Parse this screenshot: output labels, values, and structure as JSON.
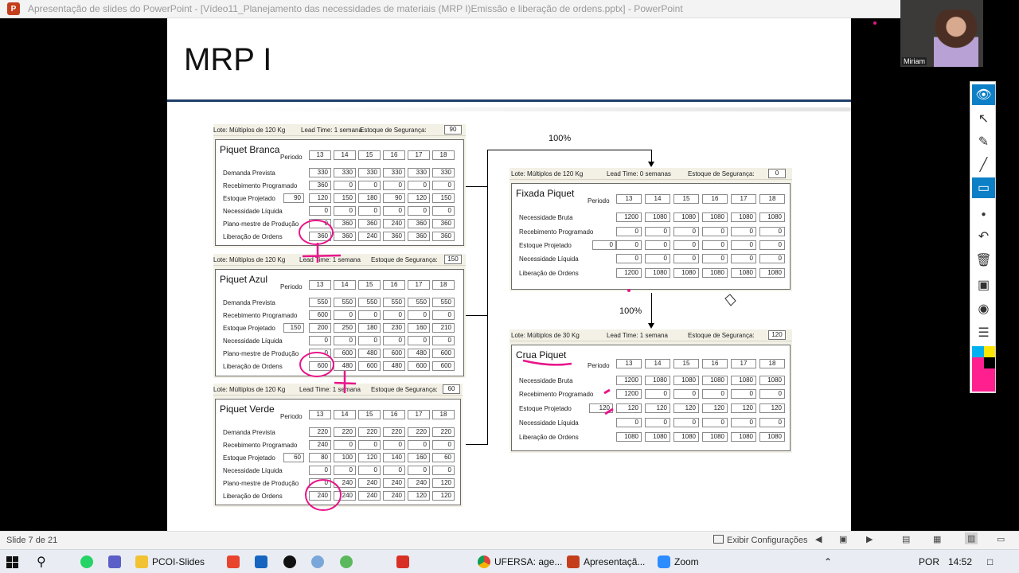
{
  "window": {
    "title": "Apresentação de slides do PowerPoint - [Vídeo11_Planejamento das necessidades de  materiais (MRP I)Emissão e liberação de ordens.pptx] - PowerPoint",
    "app_icon": "P"
  },
  "video": {
    "name": "Miriam"
  },
  "slide": {
    "title": "MRP I",
    "pct_top": "100%",
    "pct_mid": "100%",
    "periods": [
      "13",
      "14",
      "15",
      "16",
      "17",
      "18"
    ],
    "periodo_label": "Periodo",
    "panels": [
      {
        "id": "branca",
        "lote": "Lote: Múltiplos de 120 Kg",
        "lead": "Lead Time: 1 semana",
        "seg_label": "Estoque de Segurança:",
        "seg": "90",
        "name": "Piquet Branca",
        "rows": [
          {
            "label": "Demanda Prevista",
            "init": "",
            "values": [
              "330",
              "330",
              "330",
              "330",
              "330",
              "330"
            ]
          },
          {
            "label": "Recebimento Programado",
            "init": "",
            "values": [
              "360",
              "0",
              "0",
              "0",
              "0",
              "0"
            ]
          },
          {
            "label": "Estoque Projetado",
            "init": "90",
            "values": [
              "120",
              "150",
              "180",
              "90",
              "120",
              "150"
            ]
          },
          {
            "label": "Necessidade Líquida",
            "init": "",
            "values": [
              "0",
              "0",
              "0",
              "0",
              "0",
              "0"
            ]
          },
          {
            "label": "Plano-mestre de Produção",
            "init": "",
            "values": [
              "0",
              "360",
              "360",
              "240",
              "360",
              "360"
            ]
          },
          {
            "label": "Liberação de Ordens",
            "init": "",
            "values": [
              "360",
              "360",
              "240",
              "360",
              "360",
              "360"
            ]
          }
        ]
      },
      {
        "id": "azul",
        "lote": "Lote: Múltiplos de 120 Kg",
        "lead": "Lead Time: 1 semana",
        "seg_label": "Estoque de Segurança:",
        "seg": "150",
        "name": "Piquet Azul",
        "rows": [
          {
            "label": "Demanda Prevista",
            "init": "",
            "values": [
              "550",
              "550",
              "550",
              "550",
              "550",
              "550"
            ]
          },
          {
            "label": "Recebimento Programado",
            "init": "",
            "values": [
              "600",
              "0",
              "0",
              "0",
              "0",
              "0"
            ]
          },
          {
            "label": "Estoque Projetado",
            "init": "150",
            "values": [
              "200",
              "250",
              "180",
              "230",
              "160",
              "210"
            ]
          },
          {
            "label": "Necessidade Líquida",
            "init": "",
            "values": [
              "0",
              "0",
              "0",
              "0",
              "0",
              "0"
            ]
          },
          {
            "label": "Plano-mestre de Produção",
            "init": "",
            "values": [
              "0",
              "600",
              "480",
              "600",
              "480",
              "600"
            ]
          },
          {
            "label": "Liberação de Ordens",
            "init": "",
            "values": [
              "600",
              "480",
              "600",
              "480",
              "600",
              "600"
            ]
          }
        ]
      },
      {
        "id": "verde",
        "lote": "Lote: Múltiplos de 120 Kg",
        "lead": "Lead Time: 1 semana",
        "seg_label": "Estoque de Segurança:",
        "seg": "60",
        "name": "Piquet Verde",
        "rows": [
          {
            "label": "Demanda Prevista",
            "init": "",
            "values": [
              "220",
              "220",
              "220",
              "220",
              "220",
              "220"
            ]
          },
          {
            "label": "Recebimento Programado",
            "init": "",
            "values": [
              "240",
              "0",
              "0",
              "0",
              "0",
              "0"
            ]
          },
          {
            "label": "Estoque Projetado",
            "init": "60",
            "values": [
              "80",
              "100",
              "120",
              "140",
              "160",
              "60"
            ]
          },
          {
            "label": "Necessidade Líquida",
            "init": "",
            "values": [
              "0",
              "0",
              "0",
              "0",
              "0",
              "0"
            ]
          },
          {
            "label": "Plano-mestre de Produção",
            "init": "",
            "values": [
              "0",
              "240",
              "240",
              "240",
              "240",
              "120"
            ]
          },
          {
            "label": "Liberação de Ordens",
            "init": "",
            "values": [
              "240",
              "240",
              "240",
              "240",
              "120",
              "120"
            ]
          }
        ]
      },
      {
        "id": "fixada",
        "lote": "Lote: Múltiplos de 120 Kg",
        "lead": "Lead Time: 0 semanas",
        "seg_label": "Estoque de Segurança:",
        "seg": "0",
        "name": "Fixada Piquet",
        "rows": [
          {
            "label": "Necessidade Bruta",
            "init": "",
            "values": [
              "1200",
              "1080",
              "1080",
              "1080",
              "1080",
              "1080"
            ]
          },
          {
            "label": "Recebimento Programado",
            "init": "",
            "values": [
              "0",
              "0",
              "0",
              "0",
              "0",
              "0"
            ]
          },
          {
            "label": "Estoque Projetado",
            "init": "0",
            "values": [
              "0",
              "0",
              "0",
              "0",
              "0",
              "0"
            ]
          },
          {
            "label": "Necessidade Líquida",
            "init": "",
            "values": [
              "0",
              "0",
              "0",
              "0",
              "0",
              "0"
            ]
          },
          {
            "label": "Liberação de Ordens",
            "init": "",
            "values": [
              "1200",
              "1080",
              "1080",
              "1080",
              "1080",
              "1080"
            ]
          }
        ]
      },
      {
        "id": "crua",
        "lote": "Lote: Múltiplos de 30 Kg",
        "lead": "Lead Time: 1 semana",
        "seg_label": "Estoque de Segurança:",
        "seg": "120",
        "name": "Crua Piquet",
        "rows": [
          {
            "label": "Necessidade Bruta",
            "init": "",
            "values": [
              "1200",
              "1080",
              "1080",
              "1080",
              "1080",
              "1080"
            ]
          },
          {
            "label": "Recebimento Programado",
            "init": "",
            "values": [
              "1200",
              "0",
              "0",
              "0",
              "0",
              "0"
            ]
          },
          {
            "label": "Estoque Projetado",
            "init": "120",
            "values": [
              "120",
              "120",
              "120",
              "120",
              "120",
              "120"
            ]
          },
          {
            "label": "Necessidade Líquida",
            "init": "",
            "values": [
              "0",
              "0",
              "0",
              "0",
              "0",
              "0"
            ]
          },
          {
            "label": "Liberação de Ordens",
            "init": "",
            "values": [
              "1080",
              "1080",
              "1080",
              "1080",
              "1080",
              "1080"
            ]
          }
        ]
      }
    ]
  },
  "toolbar": {
    "tools": [
      "eye-icon",
      "pointer-icon",
      "pen-icon",
      "line-icon",
      "eraser-icon",
      "dot-icon",
      "undo-icon",
      "trash-icon",
      "screen-icon",
      "camera-icon",
      "clipboard-icon"
    ],
    "colors": [
      "#00b0f0",
      "#ffe600",
      "#ff1f8e",
      "#000000",
      "#ff1f8e"
    ]
  },
  "status": {
    "slide_info": "Slide 7 de 21",
    "config": "Exibir Configurações"
  },
  "taskbar": {
    "items": [
      "PCOI-Slides",
      "UFERSA: age...",
      "Apresentaçã...",
      "Zoom"
    ],
    "lang": "POR",
    "time": "14:52"
  }
}
